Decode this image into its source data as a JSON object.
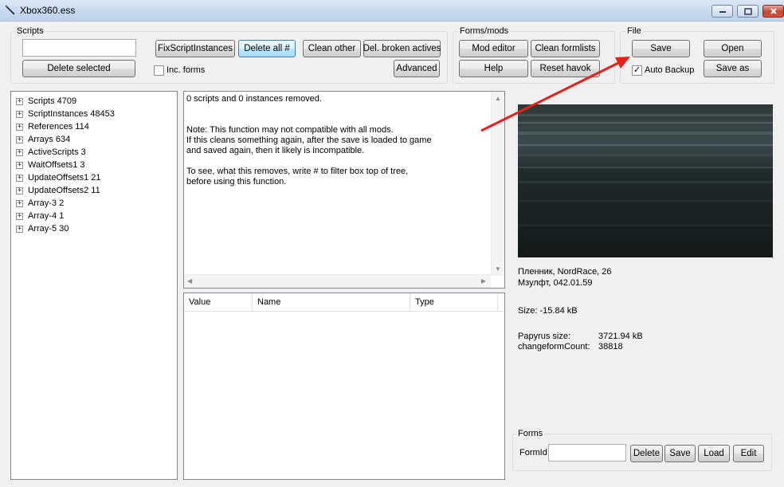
{
  "window": {
    "title": "Xbox360.ess"
  },
  "scripts": {
    "group_title": "Scripts",
    "filter_value": "",
    "delete_selected": "Delete selected",
    "fix_script_instances": "FixScriptInstances",
    "delete_all": "Delete all #",
    "clean_other": "Clean other",
    "del_broken_actives": "Del. broken actives",
    "advanced": "Advanced",
    "inc_forms_label": "Inc. forms",
    "inc_forms_checked": false
  },
  "forms_mods": {
    "group_title": "Forms/mods",
    "mod_editor": "Mod editor",
    "clean_formlists": "Clean formlists",
    "help": "Help",
    "reset_havok": "Reset havok"
  },
  "file": {
    "group_title": "File",
    "save": "Save",
    "open": "Open",
    "save_as": "Save as",
    "auto_backup_label": "Auto Backup",
    "auto_backup_checked": true,
    "auto_backup_mark": "✓"
  },
  "tree": {
    "expander_glyph": "+",
    "items": [
      "Scripts 4709",
      "ScriptInstances 48453",
      "References 114",
      "Arrays 634",
      "ActiveScripts 3",
      "WaitOffsets1 3",
      "UpdateOffsets1 21",
      "UpdateOffsets2 11",
      "Array-3 2",
      "Array-4 1",
      "Array-5 30"
    ]
  },
  "message": {
    "lines": [
      "0 scripts and 0 instances removed.",
      "",
      "",
      "Note: This function may not compatible with all mods.",
      "If this cleans something again, after the save is loaded to game",
      "and saved again, then it likely is incompatible.",
      "",
      "To see, what this removes, write # to filter box top of tree,",
      "before using this function."
    ]
  },
  "list": {
    "columns": [
      "Value",
      "Name",
      "Type"
    ]
  },
  "save_info": {
    "player_line": "Пленник, NordRace, 26",
    "location_line": "Мзулфт, 042.01.59",
    "size_line": "Size: -15.84 kB",
    "papyrus_label": "Papyrus size:",
    "papyrus_value": "3721.94 kB",
    "changeform_label": "changeformCount:",
    "changeform_value": "38818"
  },
  "forms": {
    "group_title": "Forms",
    "formid_label": "FormId",
    "formid_value": "",
    "delete": "Delete",
    "save": "Save",
    "load": "Load",
    "edit": "Edit"
  },
  "colors": {
    "annotation_arrow": "#e8201c",
    "screenshot_bg": "#1d2526",
    "accent_focus": "#3c7fb1"
  },
  "icons": {
    "app": "pen-icon",
    "minimize": "minimize-icon",
    "maximize": "maximize-icon",
    "close": "close-icon"
  }
}
